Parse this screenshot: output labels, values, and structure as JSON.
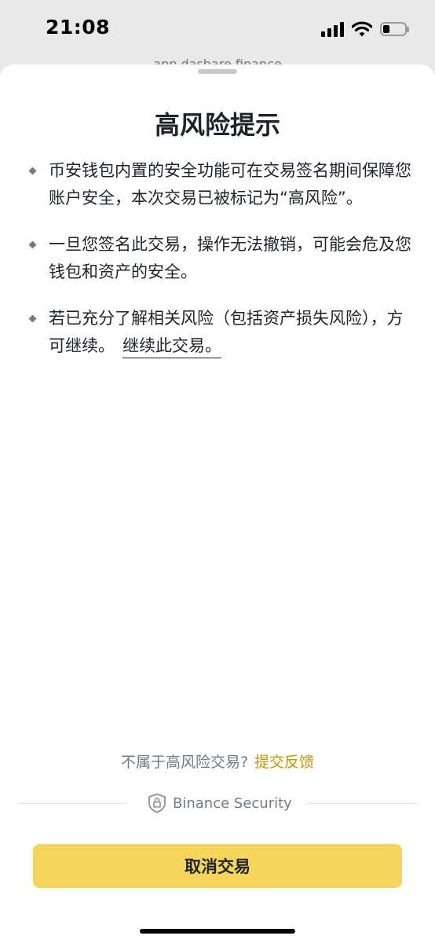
{
  "status_bar": {
    "time": "21:08",
    "icons": [
      "cellular-signal-icon",
      "wifi-icon",
      "battery-icon"
    ],
    "battery_level_percent": 30
  },
  "background_page": {
    "url": "app.dashare.finance"
  },
  "sheet": {
    "title": "高风险提示",
    "bullets": [
      "币安钱包内置的安全功能可在交易签名期间保障您账户安全，本次交易已被标记为“高风险”。",
      "一旦您签名此交易，操作无法撤销，可能会危及您钱包和资产的安全。",
      "若已充分了解相关风险（包括资产损失风险），方可继续。"
    ],
    "continue_link": "继续此交易。",
    "feedback_prompt": "不属于高风险交易?",
    "feedback_link": "提交反馈",
    "security_label": "Binance Security",
    "cancel_button": "取消交易"
  },
  "colors": {
    "accent_yellow": "#f6d55c",
    "link_gold": "#c99400",
    "text_primary": "#1e2329",
    "text_secondary": "#707a8a"
  }
}
